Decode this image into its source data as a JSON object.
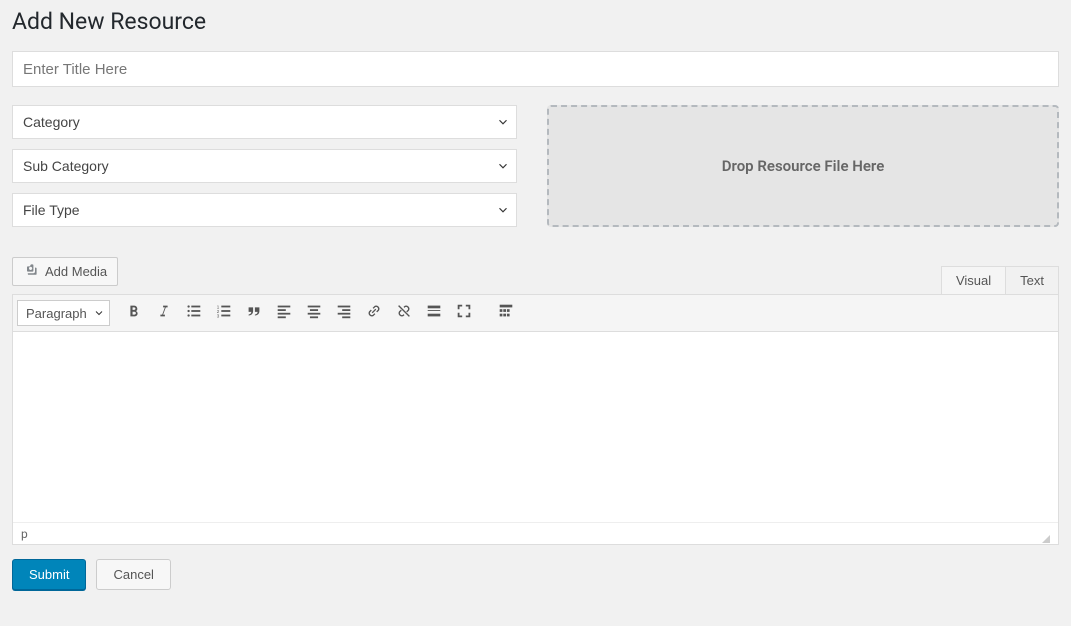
{
  "page": {
    "title": "Add New Resource"
  },
  "form": {
    "title_placeholder": "Enter Title Here",
    "category_label": "Category",
    "subcategory_label": "Sub Category",
    "filetype_label": "File Type",
    "dropzone_text": "Drop Resource File Here"
  },
  "editor": {
    "add_media_label": "Add Media",
    "tab_visual": "Visual",
    "tab_text": "Text",
    "format_select": "Paragraph",
    "status_path": "p"
  },
  "actions": {
    "submit": "Submit",
    "cancel": "Cancel"
  }
}
